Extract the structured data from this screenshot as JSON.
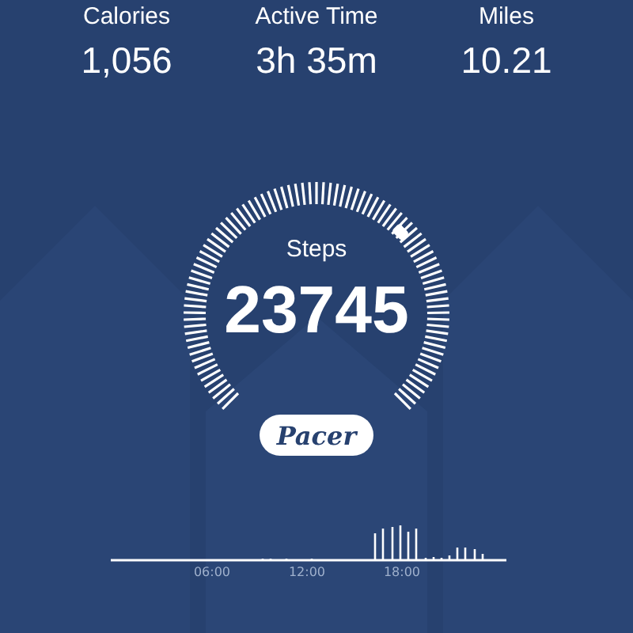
{
  "stats": [
    {
      "label": "Calories",
      "value": "1,056"
    },
    {
      "label": "Active Time",
      "value": "3h 35m"
    },
    {
      "label": "Miles",
      "value": "10.21"
    }
  ],
  "gauge": {
    "label": "Steps",
    "value": "23745"
  },
  "brand_button": {
    "label": "Pacer"
  },
  "activity_chart": {
    "time_labels": [
      "06:00",
      "12:00",
      "18:00"
    ]
  }
}
